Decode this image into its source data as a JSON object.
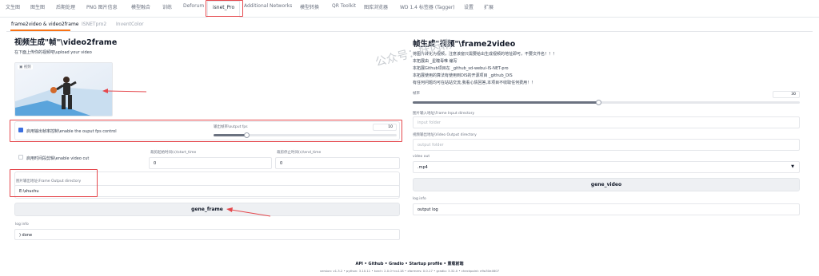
{
  "top_tabs": [
    "文生图",
    "图生图",
    "后期处理",
    "PNG 图片信息",
    "模型融合",
    "训练",
    "Deforum",
    "isnet_Pro",
    "Additional Networks",
    "模型转换",
    "QR Toolkit",
    "图库浏览器",
    "WD 1.4 标签器 (Tagger)",
    "设置",
    "扩展"
  ],
  "sub_tabs": [
    "frame2video & video2frame",
    "ISNETpro2",
    "InventColor"
  ],
  "left": {
    "title": "视频生成\"帧\"\\video2frame",
    "upload_hint": "在下面上传你的视频吧\\upload your video",
    "video_label": "视频",
    "fps_checkbox_label": "启用输出帧率控制\\enable the ouput fps control",
    "fps_checked": true,
    "fps_label": "输出帧率\\output fps",
    "fps_value": "10",
    "fps_fraction": 0.18,
    "cut_checkbox_label": "启用时间段剪辑\\enable video cut",
    "cut_checked": false,
    "start_label": "裁剪起始时间(s)\\start_time",
    "start_value": "0",
    "end_label": "裁剪停止时间(s)\\end_time",
    "end_value": "0",
    "output_dir_label": "图片输出地址\\Frame Output directory",
    "output_dir_value": "E:\\shuchu",
    "gene_button": "gene_frame",
    "log_label": "log info",
    "log_value": ") done"
  },
  "right": {
    "title": "帧生成\"视频\"\\frame2video",
    "desc": [
      "将图片转化为视频，注意该窗只需要给出生成视频的地址即可，不要文件名！！！",
      "本拓展由 _星瞳毒唯 编写",
      "本拓展Github项目在 _github_sd-webui-IS-NET-pro",
      "本拓展使用的算法有使用到DIS的开源项目 _github_DIS",
      "有任何问题均可在站站交流,我看心情回答,本项目不收取任何费用！！"
    ],
    "fps_label": "帧率",
    "fps_value": "30",
    "fps_fraction": 0.48,
    "input_dir_label": "图片输入地址\\Frame Input directory",
    "input_dir_placeholder": "input folder",
    "video_out_dir_label": "视频输出地址\\Video Output directory",
    "video_out_dir_placeholder": "output folder",
    "video_out_label": "video out",
    "video_out_value": ".mp4",
    "gene_button": "gene_video",
    "log_label": "log info",
    "log_value": "output log"
  },
  "watermark": "公众号：妖丙精",
  "footer": {
    "links": "API  •  Github  •  Gradio  •  Startup profile  •  重载前端",
    "versions": "version: v1.3.2  •  python: 3.10.11  •  torch: 2.0.0+cu118  •  xformers: 0.0.17  •  gradio: 3.32.0  •  checkpoint: e9a30e4607"
  },
  "colors": {
    "highlight": "#e5484d",
    "checkbox_on": "#3b6fe0"
  }
}
